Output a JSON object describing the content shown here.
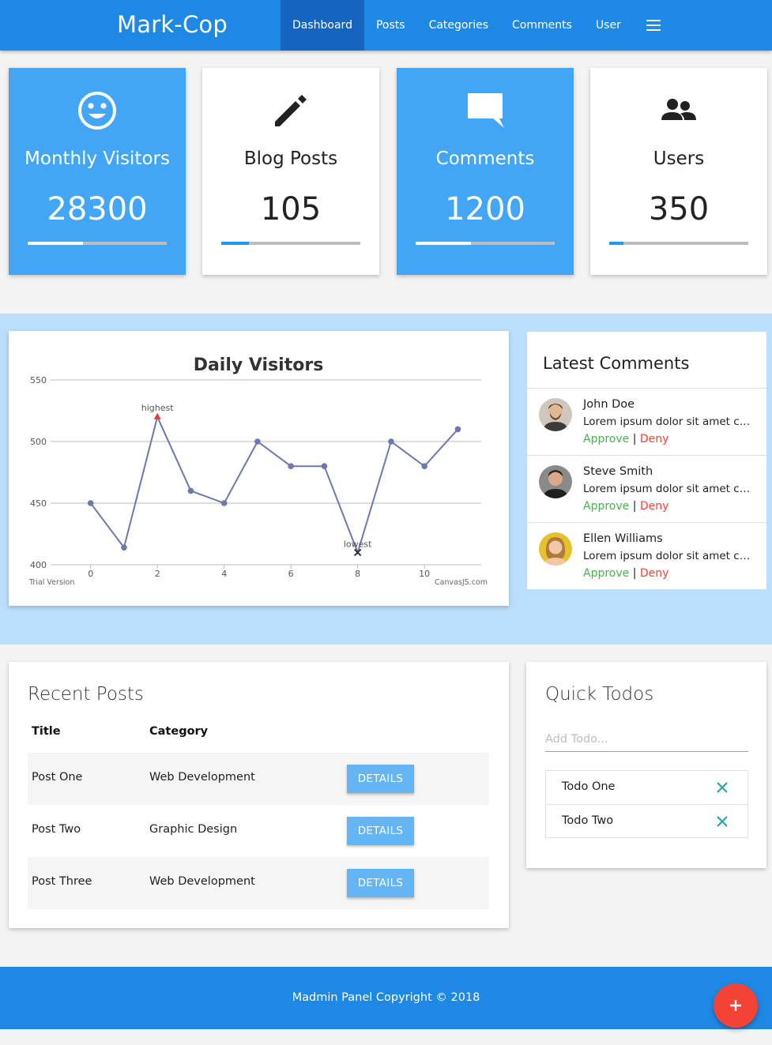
{
  "nav": {
    "brand": "Mark-Cop",
    "links": [
      {
        "label": "Dashboard",
        "active": true
      },
      {
        "label": "Posts"
      },
      {
        "label": "Categories"
      },
      {
        "label": "Comments"
      },
      {
        "label": "User"
      }
    ],
    "menu_icon": "hamburger-icon"
  },
  "stats": [
    {
      "label": "Monthly Visitors",
      "value": "28300",
      "icon": "smiley-icon",
      "progress": 0.4
    },
    {
      "label": "Blog Posts",
      "value": "105",
      "icon": "pencil-icon",
      "progress": 0.2
    },
    {
      "label": "Comments",
      "value": "1200",
      "icon": "comment-icon",
      "progress": 0.4
    },
    {
      "label": "Users",
      "value": "350",
      "icon": "users-icon",
      "progress": 0.1
    }
  ],
  "chart_data": {
    "type": "line",
    "title": "Daily Visitors",
    "xlabel": "",
    "ylabel": "",
    "x": [
      0,
      1,
      2,
      3,
      4,
      5,
      6,
      7,
      8,
      9,
      10,
      11
    ],
    "series": [
      {
        "values": [
          450,
          414,
          520,
          460,
          450,
          500,
          480,
          480,
          410,
          500,
          480,
          510
        ]
      }
    ],
    "xticks": [
      0,
      2,
      4,
      6,
      8,
      10
    ],
    "yticks": [
      400,
      450,
      500,
      550
    ],
    "ylim": [
      400,
      550
    ],
    "xlim": [
      -1.2,
      11.7
    ],
    "grid": true,
    "annotations": [
      {
        "x": 2,
        "y": 520,
        "text": "highest"
      },
      {
        "x": 8,
        "y": 410,
        "text": "lowest"
      }
    ],
    "watermarks": [
      "Trial Version",
      "CanvasJS.com"
    ],
    "line_color": "#6d78ad",
    "highest_marker_color": "#e53935"
  },
  "comments": {
    "title": "Latest Comments",
    "items": [
      {
        "name": "John Doe",
        "text": "Lorem ipsum dolor sit amet consectetur",
        "approve": "Approve",
        "deny": "Deny",
        "avatar": "avatar-john"
      },
      {
        "name": "Steve Smith",
        "text": "Lorem ipsum dolor sit amet consectetur",
        "approve": "Approve",
        "deny": "Deny",
        "avatar": "avatar-steve"
      },
      {
        "name": "Ellen Williams",
        "text": "Lorem ipsum dolor sit amet consectetur",
        "approve": "Approve",
        "deny": "Deny",
        "avatar": "avatar-ellen"
      }
    ],
    "separator": "|"
  },
  "posts": {
    "title": "Recent Posts",
    "headers": {
      "title": "Title",
      "category": "Category"
    },
    "rows": [
      {
        "title": "Post One",
        "category": "Web Development",
        "button": "DETAILS"
      },
      {
        "title": "Post Two",
        "category": "Graphic Design",
        "button": "DETAILS"
      },
      {
        "title": "Post Three",
        "category": "Web Development",
        "button": "DETAILS"
      }
    ]
  },
  "todos": {
    "title": "Quick Todos",
    "placeholder": "Add Todo...",
    "items": [
      "Todo One",
      "Todo Two"
    ]
  },
  "footer": {
    "text": "Madmin Panel Copyright © 2018",
    "fab_label": "+"
  },
  "colors": {
    "primary": "#1e88e5",
    "accent_blue": "#42a5f5",
    "band": "#bbdefb",
    "approve": "#4caf50",
    "deny": "#f44336",
    "fab": "#f44336",
    "todo_delete": "#26a69a"
  }
}
